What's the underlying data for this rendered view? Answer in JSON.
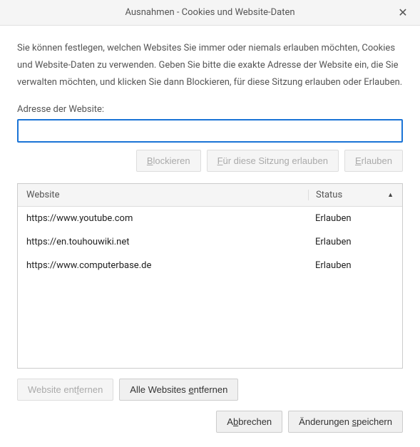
{
  "titlebar": {
    "title": "Ausnahmen - Cookies und Website-Daten"
  },
  "description": "Sie können festlegen, welchen Websites Sie immer oder niemals erlauben möchten, Cookies und Website-Daten zu verwenden. Geben Sie bitte die exakte Adresse der Website ein, die Sie verwalten möchten, und klicken Sie dann Blockieren, für diese Sitzung erlauben oder Erlauben.",
  "address_label": "Adresse der Website:",
  "url_input": {
    "value": "",
    "placeholder": ""
  },
  "buttons": {
    "block_pre": "",
    "block_mn": "B",
    "block_post": "lockieren",
    "session_pre": "",
    "session_mn": "F",
    "session_post": "ür diese Sitzung erlauben",
    "allow_pre": "",
    "allow_mn": "E",
    "allow_post": "rlauben",
    "remove_pre": "Website ent",
    "remove_mn": "f",
    "remove_post": "ernen",
    "remove_all_pre": "Alle Websites ",
    "remove_all_mn": "e",
    "remove_all_post": "ntfernen",
    "cancel_pre": "A",
    "cancel_mn": "b",
    "cancel_post": "brechen",
    "save_pre": "Änderungen ",
    "save_mn": "s",
    "save_post": "peichern"
  },
  "table": {
    "col_website": "Website",
    "col_status": "Status",
    "rows": [
      {
        "website": "https://www.youtube.com",
        "status": "Erlauben"
      },
      {
        "website": "https://en.touhouwiki.net",
        "status": "Erlauben"
      },
      {
        "website": "https://www.computerbase.de",
        "status": "Erlauben"
      }
    ]
  }
}
